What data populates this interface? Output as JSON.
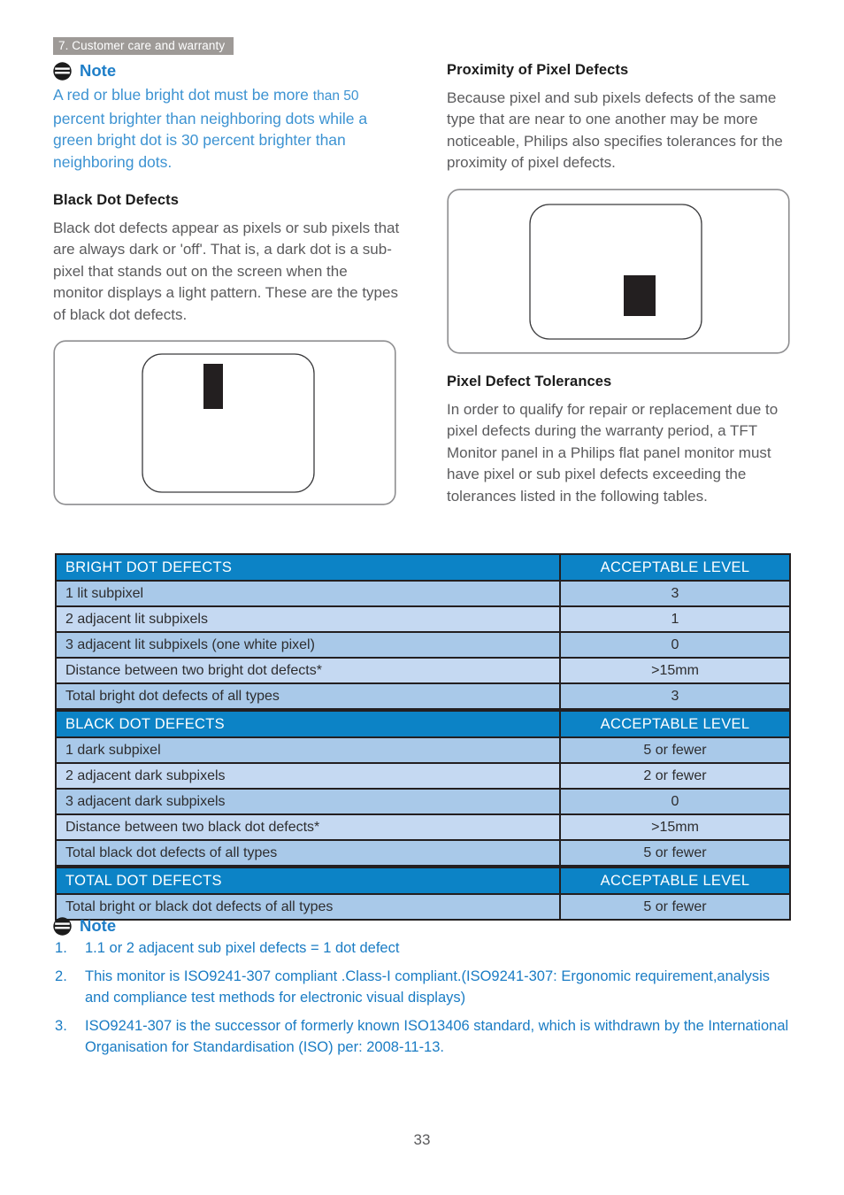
{
  "header": {
    "chapter": "7. Customer care and warranty"
  },
  "left_column": {
    "note": {
      "icon": "note-icon",
      "title": "Note",
      "text_main": "A red or blue bright dot must be more ",
      "text_small": "than 50",
      "text_rest": " percent brighter than neighboring dots while a green bright dot is 30 percent brighter than neighboring dots."
    },
    "section": {
      "heading": "Black Dot Defects",
      "paragraph": "Black dot defects appear as pixels or sub pixels that are always dark or 'off'. That is, a dark dot is a sub-pixel that stands out on the screen when the monitor displays a light pattern. These are the types of black dot defects."
    },
    "illustration": {
      "name": "black-dot-defect-diagram",
      "outer_shape": "rounded-rectangle",
      "inner_shape": "rounded-rectangle",
      "defect_shape": "dark-vertical-subpixel-bar",
      "defect_color": "#231f20"
    }
  },
  "right_column": {
    "section_proximity": {
      "heading": "Proximity of Pixel Defects",
      "paragraph": "Because pixel and sub pixels defects of the same type that are near to one another may be more noticeable, Philips also specifies tolerances for the proximity of pixel defects."
    },
    "illustration": {
      "name": "proximity-pixel-defect-diagram",
      "outer_shape": "rounded-rectangle",
      "inner_shape": "rounded-rectangle",
      "defect_shape": "dark-pixel-block",
      "defect_color": "#231f20"
    },
    "section_tolerances": {
      "heading": "Pixel Defect Tolerances",
      "paragraph": "In order to qualify for repair or replacement due to pixel defects during the warranty period, a TFT Monitor panel in a Philips flat panel monitor must have pixel or sub pixel defects exceeding the tolerances listed in the following tables."
    }
  },
  "tables": [
    {
      "id": "bright-dot-defects",
      "header": [
        "BRIGHT DOT DEFECTS",
        "ACCEPTABLE LEVEL"
      ],
      "rows": [
        [
          "1 lit subpixel",
          "3"
        ],
        [
          "2 adjacent lit subpixels",
          "1"
        ],
        [
          "3 adjacent lit subpixels (one white pixel)",
          "0"
        ],
        [
          "Distance between two bright dot defects*",
          ">15mm"
        ],
        [
          "Total bright dot defects of all types",
          "3"
        ]
      ]
    },
    {
      "id": "black-dot-defects",
      "header": [
        "BLACK DOT DEFECTS",
        "ACCEPTABLE LEVEL"
      ],
      "rows": [
        [
          "1 dark subpixel",
          "5 or fewer"
        ],
        [
          "2 adjacent dark subpixels",
          "2 or fewer"
        ],
        [
          "3 adjacent dark subpixels",
          "0"
        ],
        [
          "Distance between two black dot defects*",
          ">15mm"
        ],
        [
          "Total black dot defects of all types",
          "5 or fewer"
        ]
      ]
    },
    {
      "id": "total-dot-defects",
      "header": [
        "TOTAL DOT DEFECTS",
        "ACCEPTABLE LEVEL"
      ],
      "rows": [
        [
          "Total bright or black dot defects of all types",
          "5 or fewer"
        ]
      ]
    }
  ],
  "footnote": {
    "icon": "note-icon",
    "title": "Note",
    "items": [
      "1.1 or 2 adjacent sub pixel defects = 1 dot defect",
      "This monitor is ISO9241-307 compliant .Class-I compliant.(ISO9241-307: Ergonomic requirement,analysis and compliance test methods for electronic visual displays)",
      "ISO9241-307 is the successor of formerly known ISO13406 standard, which is withdrawn by the International Organisation for Standardisation (ISO) per: 2008-11-13."
    ]
  },
  "page_number": "33",
  "colors": {
    "chapter_band": "#9e9a97",
    "note_blue": "#1a7cc4",
    "note_body_blue": "#3d93d2",
    "table_header_blue": "#0c83c6",
    "table_row_dark": "#a9c9e9",
    "table_row_light": "#c5d9f2",
    "defect_black": "#231f20",
    "body_text": "#5b5b5d"
  }
}
